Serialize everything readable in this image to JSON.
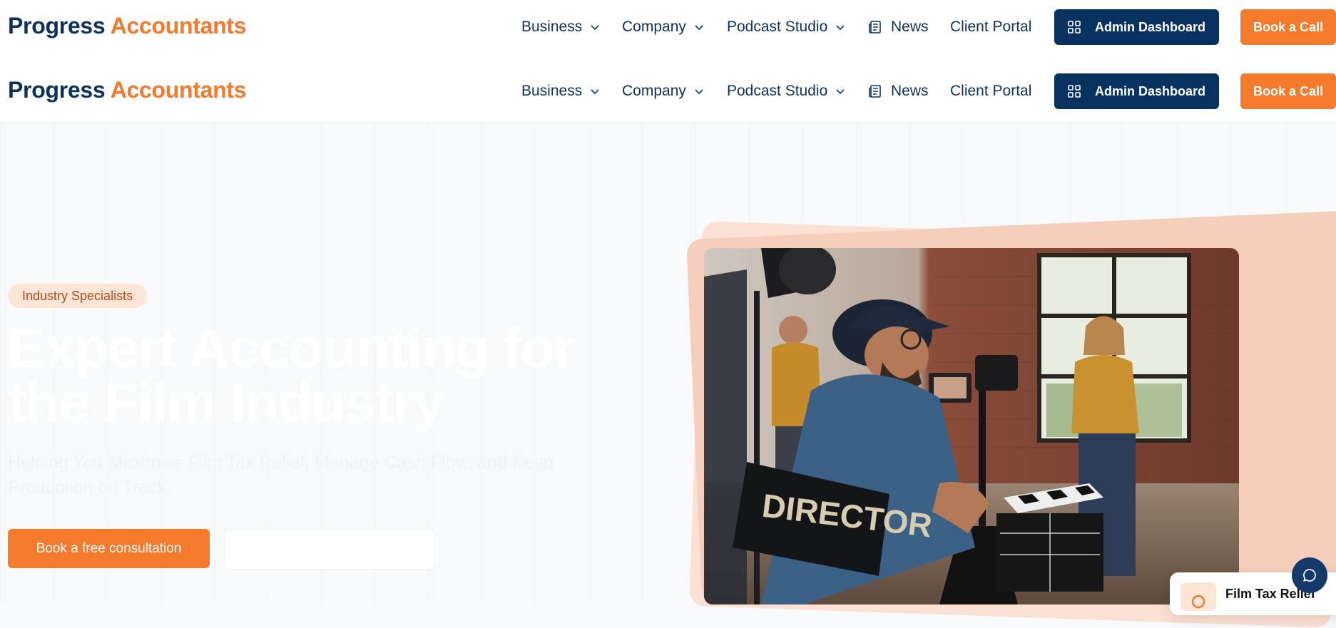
{
  "brand": {
    "part1": "Progress",
    "part2": "Accountants"
  },
  "nav": {
    "business": "Business",
    "company": "Company",
    "podcast_studio": "Podcast Studio",
    "news": "News",
    "client_portal": "Client Portal",
    "admin_dashboard": "Admin Dashboard",
    "book_call": "Book a Call"
  },
  "hero": {
    "badge": "Industry Specialists",
    "headline": "Expert Accounting for the Film Industry",
    "subheadline": "Helping You Maximise Film Tax Relief, Manage Cash Flow, and Keep Production on Track",
    "cta_primary": "Book a free consultation",
    "cta_secondary": "",
    "photo_chair_text": "DIRECTOR",
    "info_card_title": "Film Tax Relief"
  },
  "colors": {
    "navy": "#07315e",
    "orange": "#f47a2c",
    "badge_bg": "#fde6d6",
    "badge_text": "#b8471a"
  },
  "icons": {
    "chevron": "chevron-down-icon",
    "news": "newspaper-icon",
    "dashboard": "grid-icon",
    "chat": "chat-bubble-icon"
  }
}
